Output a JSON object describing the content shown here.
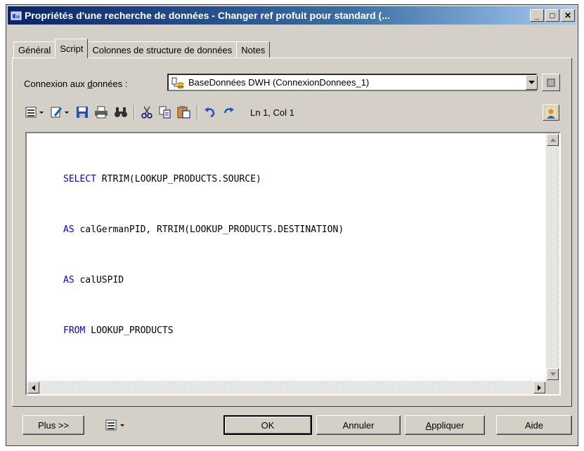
{
  "window": {
    "title": "Propriétés d'une recherche de données - Changer ref profuit pour standard (...",
    "minimize_label": "_",
    "maximize_label": "□",
    "close_label": "✕"
  },
  "tabs": [
    {
      "label": "Général",
      "active": false
    },
    {
      "label": "Script",
      "active": true
    },
    {
      "label": "Colonnes de structure de données",
      "active": false
    },
    {
      "label": "Notes",
      "active": false
    }
  ],
  "connection": {
    "label_prefix": "Connexion aux ",
    "label_underlined": "d",
    "label_suffix": "onnées :",
    "value": "BaseDonnées DWH (ConnexionDonnees_1)",
    "icon": "database-connection-icon"
  },
  "toolbar": {
    "cursor_position": "Ln 1, Col 1",
    "icons": [
      "menu-list-icon",
      "edit-icon",
      "save-icon",
      "print-icon",
      "find-icon",
      "cut-icon",
      "copy-icon",
      "paste-icon",
      "undo-icon",
      "redo-icon",
      "user-icon"
    ]
  },
  "editor": {
    "lines": [
      {
        "kw": "SELECT",
        "rest": " RTRIM(LOOKUP_PRODUCTS.SOURCE)"
      },
      {
        "kw": "AS",
        "rest": " calGermanPID, RTRIM(LOOKUP_PRODUCTS.DESTINATION)"
      },
      {
        "kw": "AS",
        "rest": " calUSPID"
      },
      {
        "kw": "FROM",
        "rest": " LOOKUP_PRODUCTS"
      }
    ]
  },
  "buttons": {
    "more": "Plus >>",
    "ok": "OK",
    "cancel": "Annuler",
    "apply_first": "A",
    "apply_rest": "ppliquer",
    "help": "Aide"
  },
  "colors": {
    "keyword": "#0000ff",
    "title_start": "#0a246a",
    "title_end": "#a6caf0",
    "face": "#d4d0c8"
  }
}
